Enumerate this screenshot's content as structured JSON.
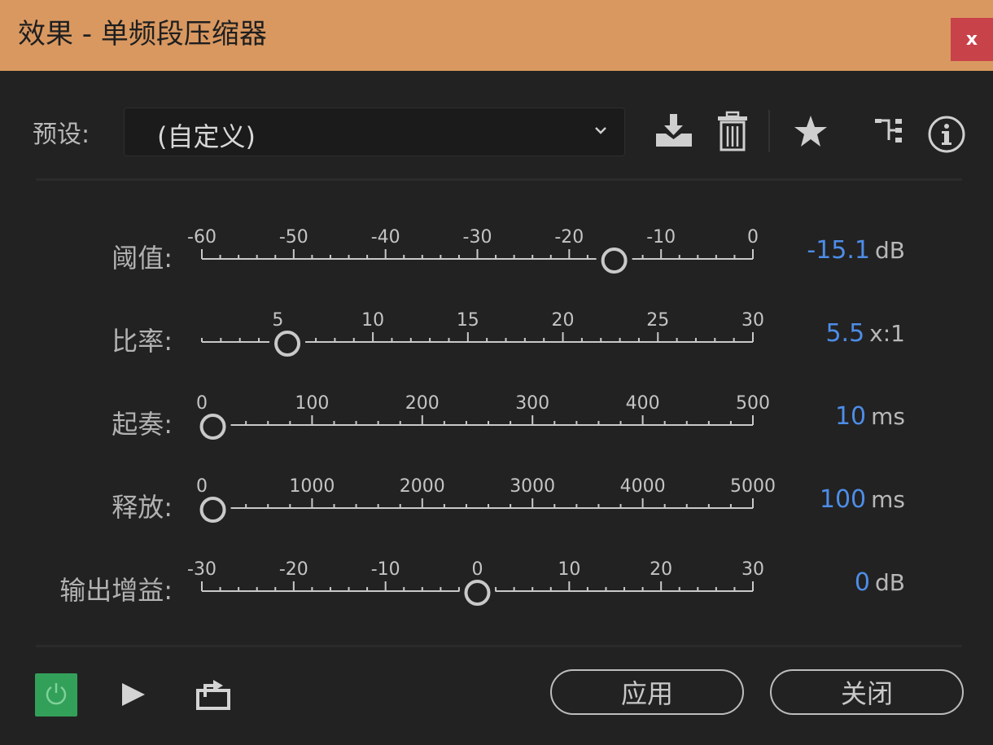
{
  "window": {
    "title": "效果 - 单频段压缩器",
    "close_label": "x",
    "titlebar_color": "#d99860",
    "close_color": "#c8424a"
  },
  "preset": {
    "label": "预设:",
    "value": "(自定义)"
  },
  "toolbar_icons": [
    "download-icon",
    "trash-icon",
    "star-icon",
    "routing-icon",
    "info-icon"
  ],
  "accent_color": "#4d8de8",
  "controls": [
    {
      "label": "阈值:",
      "value": "-15.1",
      "unit": "dB",
      "min": -60,
      "max": 0,
      "current": -15.1,
      "ticks": [
        "-60",
        "-50",
        "-40",
        "-30",
        "-20",
        "-10",
        "0"
      ]
    },
    {
      "label": "比率:",
      "value": "5.5",
      "unit": "x:1",
      "min": 1,
      "max": 30,
      "current": 5.5,
      "ticks": [
        "5",
        "10",
        "15",
        "20",
        "25",
        "30"
      ],
      "tick_values": [
        5,
        10,
        15,
        20,
        25,
        30
      ]
    },
    {
      "label": "起奏:",
      "value": "10",
      "unit": "ms",
      "min": 0,
      "max": 500,
      "current": 10,
      "ticks": [
        "0",
        "100",
        "200",
        "300",
        "400",
        "500"
      ]
    },
    {
      "label": "释放:",
      "value": "100",
      "unit": "ms",
      "min": 0,
      "max": 5000,
      "current": 100,
      "ticks": [
        "0",
        "1000",
        "2000",
        "3000",
        "4000",
        "5000"
      ]
    },
    {
      "label": "输出增益:",
      "value": "0",
      "unit": "dB",
      "min": -30,
      "max": 30,
      "current": 0,
      "ticks": [
        "-30",
        "-20",
        "-10",
        "0",
        "10",
        "20",
        "30"
      ]
    }
  ],
  "footer": {
    "power_color": "#33a05a",
    "apply_label": "应用",
    "close_label": "关闭"
  }
}
